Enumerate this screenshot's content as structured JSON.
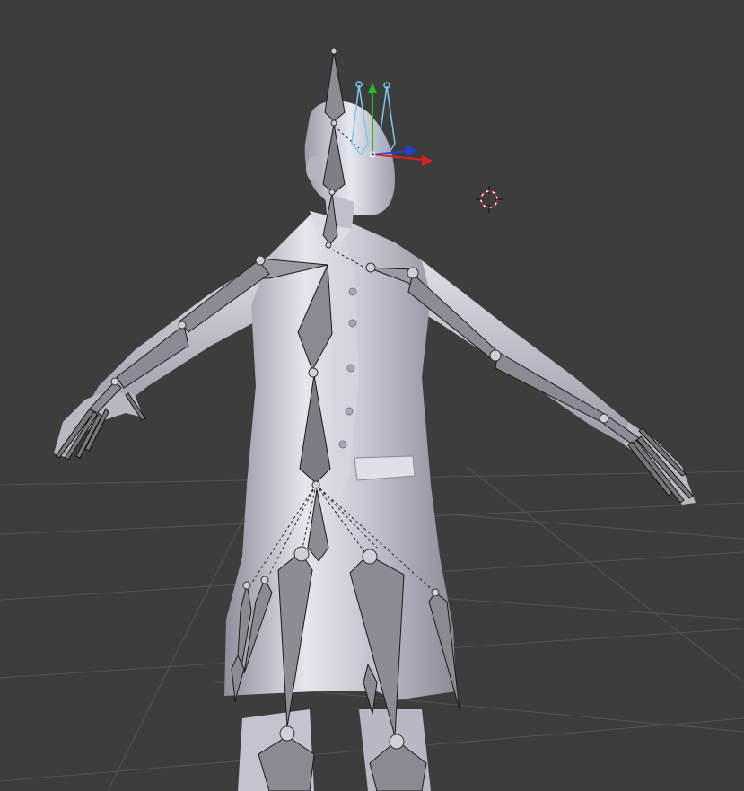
{
  "viewport": {
    "name": "3D Viewport",
    "background": "#3d3d3d",
    "grid_color": "#525252",
    "mesh_color": "#c8c8d2",
    "mesh_shade": "#9a9aa6",
    "bone_fill": "#8c8c94",
    "bone_dark": "#5a5a60",
    "bone_outline": "#1a1a1a",
    "selected_bone_color": "#7ec8f0",
    "cursor_color": "#e01818"
  },
  "gizmo": {
    "x_axis_color": "#e02020",
    "y_axis_color": "#20c020",
    "z_axis_color": "#2040e0"
  },
  "icons": {
    "cursor": "3d-cursor-icon",
    "gizmo": "transform-gizmo-icon"
  }
}
